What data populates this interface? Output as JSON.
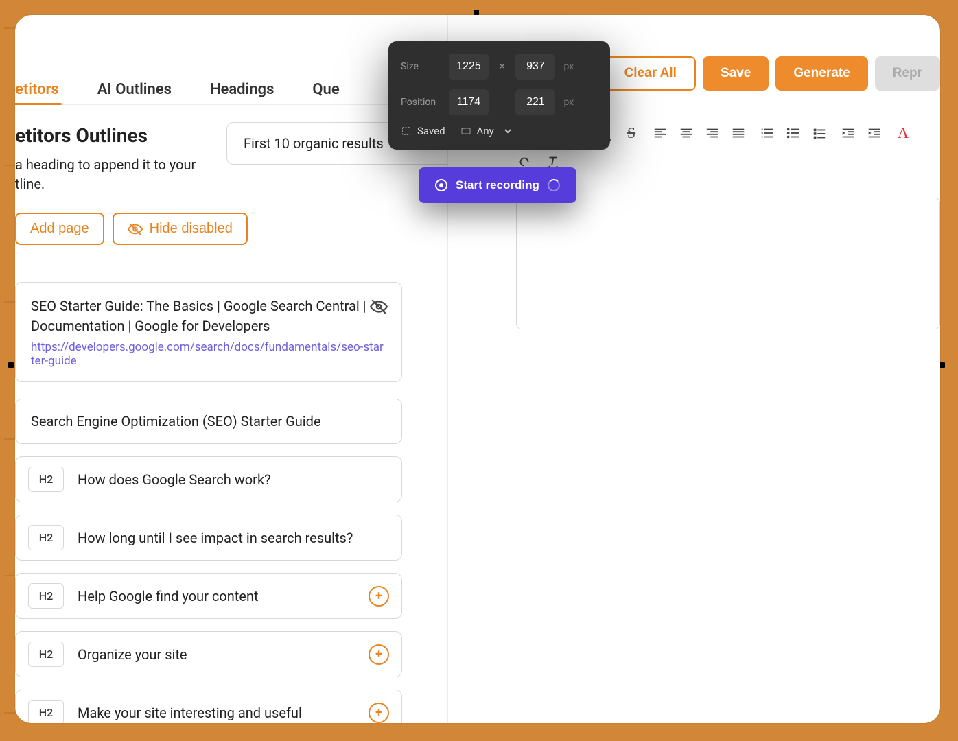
{
  "tabs": {
    "competitors": "etitors",
    "ai_outlines": "AI Outlines",
    "headings": "Headings",
    "questions": "Que"
  },
  "header": {
    "title": "etitors Outlines",
    "subtitle_a": "a heading to append it to your",
    "subtitle_b": "tline."
  },
  "buttons": {
    "add_page": "Add page",
    "hide_disabled": "Hide disabled"
  },
  "filter": {
    "label": "First 10 organic results"
  },
  "result_card": {
    "title": "SEO Starter Guide: The Basics | Google Search Central | Documentation | Google for Developers",
    "url": "https://developers.google.com/search/docs/fundamentals/seo-starter-guide"
  },
  "h1_card": "Search Engine Optimization (SEO) Starter Guide",
  "headings_list": [
    {
      "tag": "H2",
      "text": "How does Google Search work?",
      "expandable": false
    },
    {
      "tag": "H2",
      "text": "How long until I see impact in search results?",
      "expandable": false
    },
    {
      "tag": "H2",
      "text": "Help Google find your content",
      "expandable": true
    },
    {
      "tag": "H2",
      "text": "Organize your site",
      "expandable": true
    },
    {
      "tag": "H2",
      "text": "Make your site interesting and useful",
      "expandable": true
    }
  ],
  "top_actions": {
    "clear_all": "Clear All",
    "save": "Save",
    "generate": "Generate",
    "repr": "Repr"
  },
  "recorder": {
    "size_label": "Size",
    "size_w": "1225",
    "size_h": "937",
    "pos_label": "Position",
    "pos_x": "1174",
    "pos_y": "221",
    "unit": "px",
    "x_sep": "×",
    "saved": "Saved",
    "any": "Any",
    "start": "Start recording"
  }
}
